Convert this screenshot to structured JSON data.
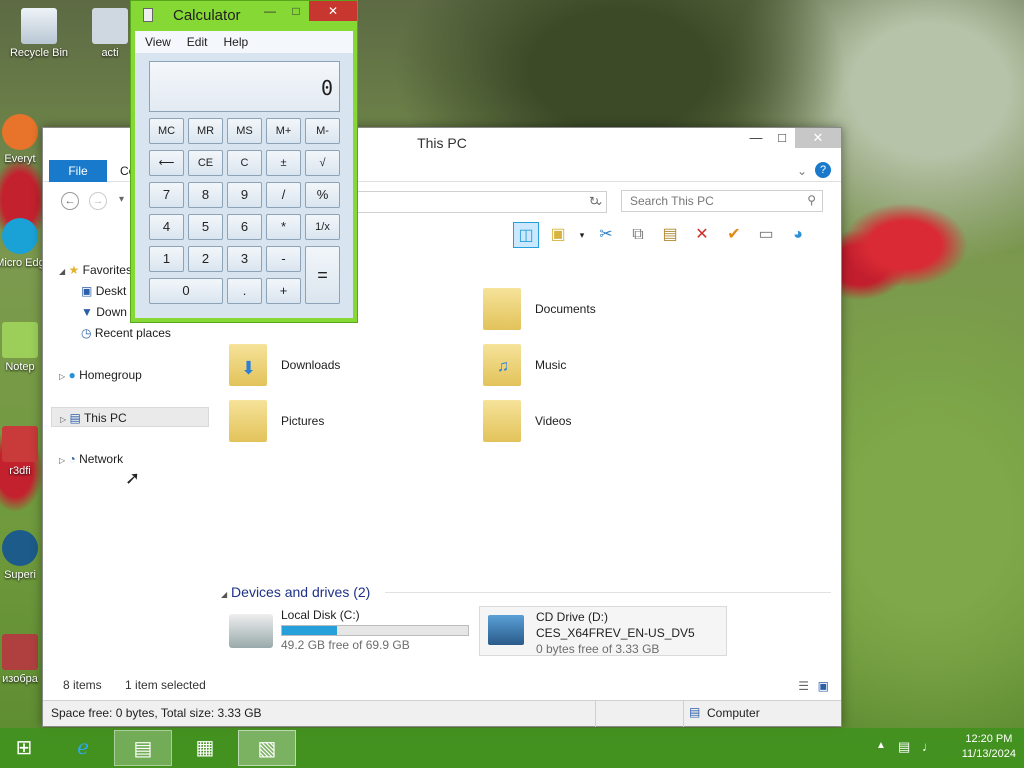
{
  "desktop": {
    "icons": [
      {
        "label": "Recycle Bin"
      },
      {
        "label": "acti"
      },
      {
        "label": "Everyt"
      },
      {
        "label": "Micro Edg"
      },
      {
        "label": "Notep"
      },
      {
        "label": "r3dfi"
      },
      {
        "label": "Superi"
      },
      {
        "label": "изобра"
      }
    ]
  },
  "explorer": {
    "title": "This PC",
    "tabs": {
      "file": "File",
      "computer": "Co"
    },
    "search_placeholder": "Search This PC",
    "nav": {
      "favorites": "Favorites",
      "desktop": "Deskt",
      "downloads": "Down",
      "recent": "Recent places",
      "homegroup": "Homegroup",
      "thispc": "This PC",
      "network": "Network"
    },
    "folders": [
      {
        "name": "Documents"
      },
      {
        "name": "Downloads"
      },
      {
        "name": "Music"
      },
      {
        "name": "Pictures"
      },
      {
        "name": "Videos"
      }
    ],
    "devices_title": "Devices and drives (2)",
    "drives": [
      {
        "name": "Local Disk (C:)",
        "free": "49.2 GB free of 69.9 GB",
        "used_fraction": 0.296
      },
      {
        "name": "CD Drive (D:)",
        "label": "CES_X64FREV_EN-US_DV5",
        "free": "0 bytes free of 3.33 GB"
      }
    ],
    "status": {
      "items": "8 items",
      "selected": "1 item selected"
    },
    "bottom": {
      "space": "Space free: 0 bytes, Total size: 3.33 GB",
      "computer": "Computer"
    }
  },
  "calculator": {
    "title": "Calculator",
    "menu": [
      "View",
      "Edit",
      "Help"
    ],
    "display": "0",
    "keys": [
      "MC",
      "MR",
      "MS",
      "M+",
      "M-",
      "⟵",
      "CE",
      "C",
      "±",
      "√",
      "7",
      "8",
      "9",
      "/",
      "%",
      "4",
      "5",
      "6",
      "*",
      "1/x",
      "1",
      "2",
      "3",
      "-",
      "=",
      "0",
      ".",
      "+"
    ]
  },
  "taskbar": {
    "time": "12:20 PM",
    "date": "11/13/2024"
  }
}
